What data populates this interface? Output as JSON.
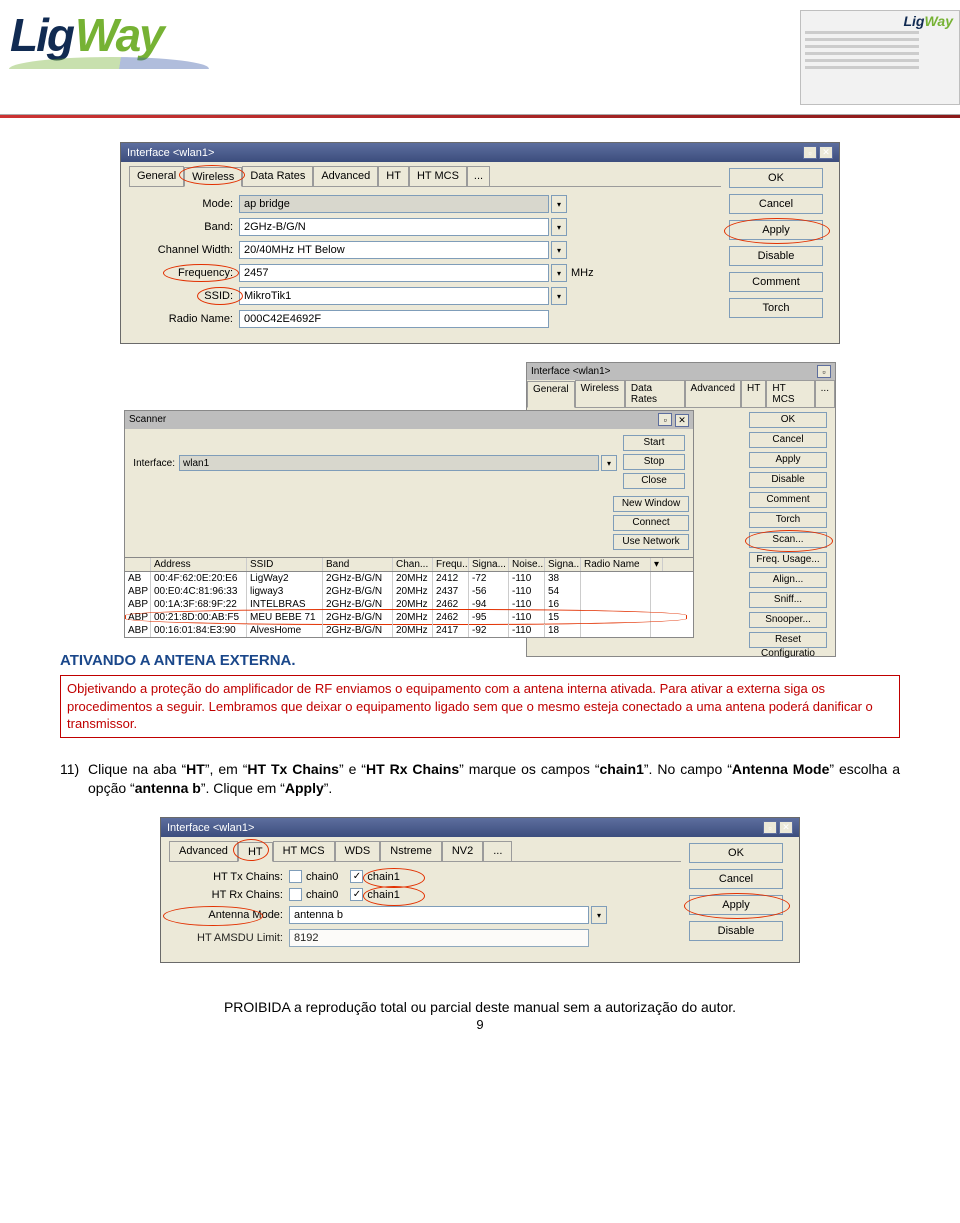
{
  "header": {
    "logo_a": "Lig",
    "logo_b": "Way"
  },
  "dialog1": {
    "title": "Interface <wlan1>",
    "tabs": [
      "General",
      "Wireless",
      "Data Rates",
      "Advanced",
      "HT",
      "HT MCS",
      "..."
    ],
    "active_tab": "Wireless",
    "fields": {
      "mode_label": "Mode:",
      "mode_value": "ap bridge",
      "band_label": "Band:",
      "band_value": "2GHz-B/G/N",
      "chwidth_label": "Channel Width:",
      "chwidth_value": "20/40MHz HT Below",
      "freq_label": "Frequency:",
      "freq_value": "2457",
      "freq_unit": "MHz",
      "ssid_label": "SSID:",
      "ssid_value": "MikroTik1",
      "radio_label": "Radio Name:",
      "radio_value": "000C42E4692F"
    },
    "buttons": [
      "OK",
      "Cancel",
      "Apply",
      "Disable",
      "Comment",
      "Torch"
    ]
  },
  "small_dialog": {
    "title": "Interface <wlan1>",
    "tabs": [
      "General",
      "Wireless",
      "Data Rates",
      "Advanced",
      "HT",
      "HT MCS",
      "..."
    ],
    "buttons": [
      "OK",
      "Cancel",
      "Apply",
      "Disable",
      "Comment",
      "Torch",
      "Scan...",
      "Freq. Usage...",
      "Align...",
      "Sniff...",
      "Snooper...",
      "Reset Configuratio"
    ]
  },
  "scanner": {
    "title": "Scanner",
    "interface_label": "Interface:",
    "interface_value": "wlan1",
    "btns_top": [
      "Start",
      "Stop",
      "Close"
    ],
    "btns_mid": [
      "New Window",
      "Connect",
      "Use Network"
    ],
    "columns": [
      "",
      "Address",
      "SSID",
      "Band",
      "Chan...",
      "Frequ...",
      "Signa...",
      "Noise...",
      "Signa...",
      "Radio Name"
    ],
    "rows": [
      {
        "flag": "AB",
        "addr": "00:4F:62:0E:20:E6",
        "ssid": "LigWay2",
        "band": "2GHz-B/G/N",
        "chan": "20MHz",
        "freq": "2412",
        "sig": "-72",
        "noise": "-110",
        "snr": "38",
        "radio": ""
      },
      {
        "flag": "ABP",
        "addr": "00:E0:4C:81:96:33",
        "ssid": "ligway3",
        "band": "2GHz-B/G/N",
        "chan": "20MHz",
        "freq": "2437",
        "sig": "-56",
        "noise": "-110",
        "snr": "54",
        "radio": ""
      },
      {
        "flag": "ABP",
        "addr": "00:1A:3F:68:9F:22",
        "ssid": "INTELBRAS",
        "band": "2GHz-B/G/N",
        "chan": "20MHz",
        "freq": "2462",
        "sig": "-94",
        "noise": "-110",
        "snr": "16",
        "radio": ""
      },
      {
        "flag": "ABP",
        "addr": "00:21:8D:00:AB:F5",
        "ssid": "MEU BEBE 71",
        "band": "2GHz-B/G/N",
        "chan": "20MHz",
        "freq": "2462",
        "sig": "-95",
        "noise": "-110",
        "snr": "15",
        "radio": ""
      },
      {
        "flag": "ABP",
        "addr": "00:16:01:84:E3:90",
        "ssid": "AlvesHome",
        "band": "2GHz-B/G/N",
        "chan": "20MHz",
        "freq": "2417",
        "sig": "-92",
        "noise": "-110",
        "snr": "18",
        "radio": ""
      }
    ]
  },
  "text": {
    "section_title": "ATIVANDO A ANTENA EXTERNA.",
    "warning": "Objetivando a proteção do amplificador de RF enviamos o equipamento com a antena interna ativada. Para ativar a externa siga os procedimentos a seguir. Lembramos que deixar o equipamento ligado sem que o mesmo esteja conectado a uma antena poderá danificar o transmissor.",
    "step_num": "11)",
    "step_text_a": "Clique na aba “",
    "step_ht": "HT",
    "step_text_b": "”, em “",
    "step_tx": "HT Tx Chains",
    "step_text_c": "” e “",
    "step_rx": "HT Rx Chains",
    "step_text_d": "” marque os campos “",
    "step_chain1": "chain1",
    "step_text_e": "”. No campo “",
    "step_ant": "Antenna Mode",
    "step_text_f": "” escolha a opção “",
    "step_antb": "antenna b",
    "step_text_g": "”. Clique em “",
    "step_apply": "Apply",
    "step_text_h": "”."
  },
  "dialog3": {
    "title": "Interface <wlan1>",
    "tabs": [
      "Advanced",
      "HT",
      "HT MCS",
      "WDS",
      "Nstreme",
      "NV2",
      "..."
    ],
    "tx_label": "HT Tx Chains:",
    "rx_label": "HT Rx Chains:",
    "chain0": "chain0",
    "chain1": "chain1",
    "antmode_label": "Antenna Mode:",
    "antmode_value": "antenna b",
    "amsdu_label": "HT AMSDU Limit:",
    "amsdu_value": "8192",
    "buttons": [
      "OK",
      "Cancel",
      "Apply",
      "Disable"
    ]
  },
  "footer": {
    "text": "PROIBIDA a reprodução total ou parcial deste manual sem a autorização do autor.",
    "page": "9"
  }
}
